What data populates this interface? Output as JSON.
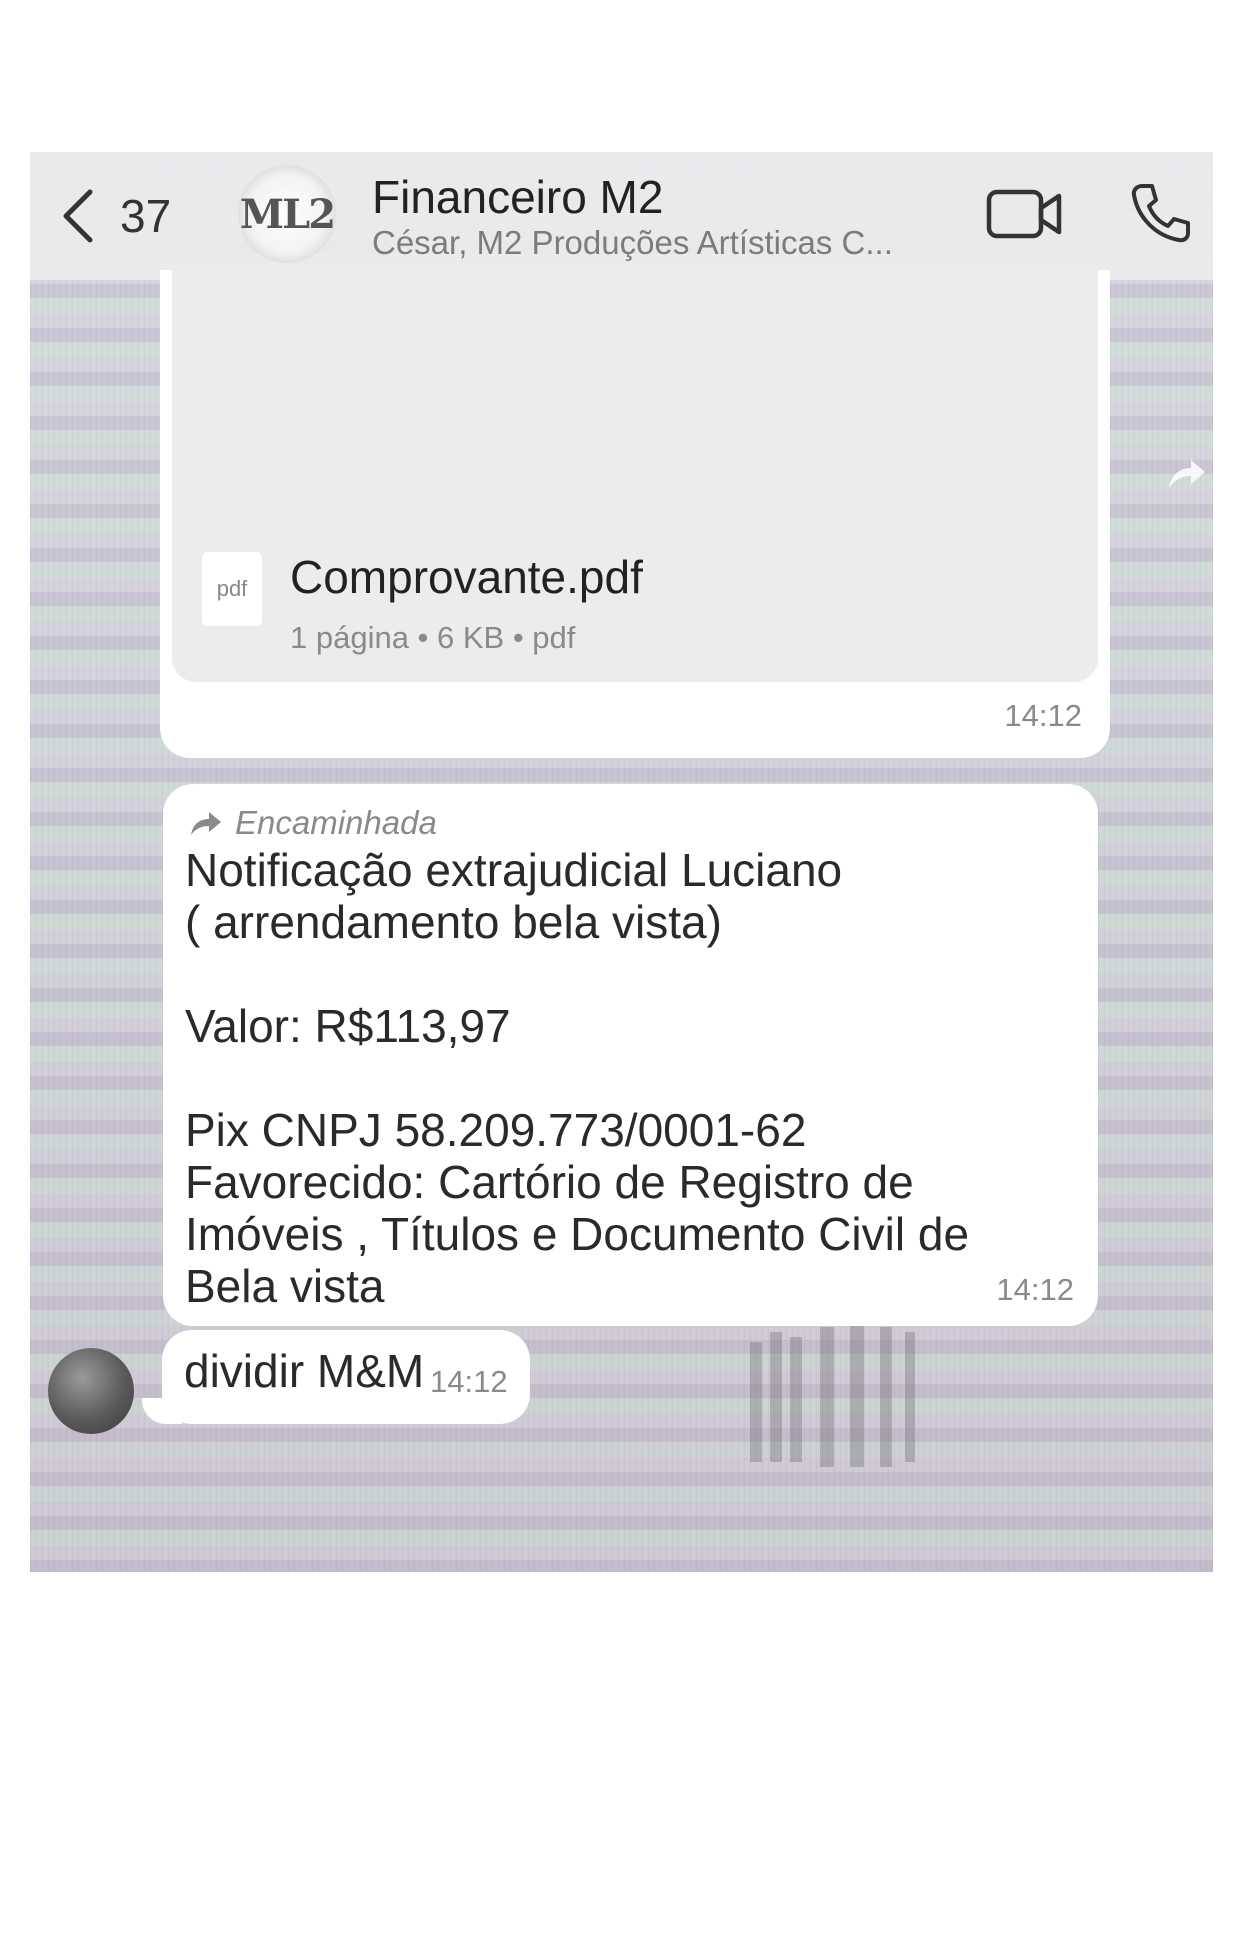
{
  "header": {
    "back_count": "37",
    "avatar_logo": "ML2",
    "title": "Financeiro M2",
    "subtitle": "César, M2 Produções Artísticas C..."
  },
  "messages": {
    "document": {
      "file_name": "Comprovante.pdf",
      "file_icon_label": "pdf",
      "file_meta": "1 página • 6 KB • pdf",
      "time": "14:12"
    },
    "forwarded": {
      "forward_label": "Encaminhada",
      "lines": {
        "l1": "Notificação extrajudicial Luciano",
        "l2": "( arrendamento bela vista)",
        "l3": "Valor: R$113,97",
        "l4": "Pix CNPJ 58.209.773/0001-62",
        "l5": "Favorecido: Cartório de Registro de",
        "l6": "Imóveis , Títulos e Documento Civil de",
        "l7": "Bela vista"
      },
      "time": "14:12"
    },
    "short": {
      "text": "dividir M&M",
      "time": "14:12"
    }
  },
  "icons": {
    "back": "chevron-left-icon",
    "video": "video-camera-icon",
    "call": "phone-icon",
    "forward": "forward-arrow-icon",
    "file": "pdf-file-icon"
  },
  "colors": {
    "bubble": "#ffffff",
    "doc_card": "#ececee",
    "header": "#ececee",
    "meta_text": "#8a8a8a"
  }
}
